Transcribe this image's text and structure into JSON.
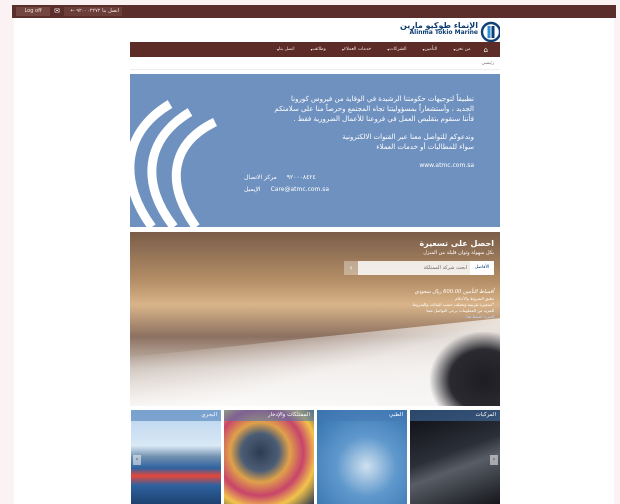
{
  "topbar": {
    "logout_label": "Log off",
    "contact_label": "اتصل بنا ٩٢٠٠٠٢٢٧٢ ←"
  },
  "logo": {
    "arabic": "الإنماء طوكيو مارين",
    "english": "Alinma Tokio Marine"
  },
  "nav": {
    "items": [
      "من نحن",
      "التأمين",
      "الشركات",
      "خدمات العملاء",
      "وظائف",
      "اتصل بنا"
    ]
  },
  "breadcrumb": "رئيسي",
  "covid": {
    "lines": [
      "تطبيقاً لتوجيهات حكومتنا الرشيدة في الوقاية من فيروس كورونا",
      "الجديد ، وأستشعاراً بمسؤوليتنا تجاه المجتمع وحرصاً منا على سلامتكم",
      "فأننا سنقوم بتقليص العمل في فروعنا للأعمال الضرورية فقط ."
    ],
    "contact_lines": [
      "وندعوكم للتواصل معنا عبر القنوات الالكترونية",
      "سواء للمطالبات أو خدمات العملاء"
    ],
    "website": "www.atmc.com.sa",
    "phone_label": "مركز الاتصال",
    "phone": "٩٢٠٠٠٨٤٢٤",
    "email_label": "الإيميل",
    "email": "Care@atmc.com.sa"
  },
  "hero": {
    "title": "احصل على تسعيرة",
    "subtitle": "بكل سهولة وثوان قليلة من المنزل",
    "select_value": "الأفاضل",
    "input_placeholder": "ابحث شركة الممتلكة",
    "price_line": "أقساط التأمين 600.00 ريال سعودي",
    "price_sub": "تطبق الشروط والأحكام",
    "note_lines": [
      "*تسعيرة تقريبية وتختلف حسب البيانات والشروط",
      "للمزيد من المعلومات يرجى التواصل معنا"
    ],
    "link": "للمزيد اضغط هنا"
  },
  "tiles": [
    {
      "label": "المركبات",
      "key": "vehicles"
    },
    {
      "label": "الطبي",
      "key": "medical"
    },
    {
      "label": "الممتلكات والإدخار",
      "key": "property"
    },
    {
      "label": "البحري",
      "key": "marine"
    }
  ],
  "colors": {
    "brand_dark": "#5d2c27",
    "banner_blue": "#6f91bf",
    "logo_blue": "#0f3f73"
  }
}
